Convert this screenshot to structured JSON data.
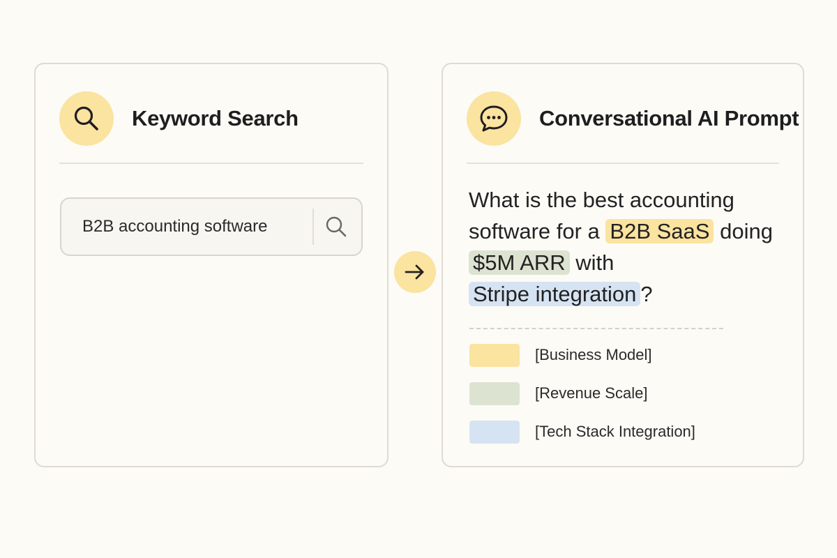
{
  "colors": {
    "accent_yellow": "#fbe3a0",
    "business_model": "#fbe3a0",
    "revenue_scale": "#dde3d1",
    "tech_stack": "#d6e3f2",
    "border": "#dddbd3",
    "background": "#fcfbf6"
  },
  "left_panel": {
    "icon": "search-icon",
    "title": "Keyword Search",
    "search": {
      "value": "B2B accounting software",
      "button_icon": "search-icon"
    }
  },
  "connector": {
    "icon": "arrow-right-icon"
  },
  "right_panel": {
    "icon": "chat-bubble-icon",
    "title": "Conversational AI Prompt",
    "prompt": {
      "part1": "What is the best accounting software for a ",
      "business_model": "B2B SaaS",
      "part2": " doing ",
      "revenue_scale": "$5M ARR",
      "part3": " with ",
      "tech_stack": "Stripe integration",
      "part4": "?"
    },
    "legend": [
      {
        "label": "[Business Model]",
        "color": "#fbe3a0"
      },
      {
        "label": "[Revenue Scale]",
        "color": "#dde3d1"
      },
      {
        "label": "[Tech Stack Integration]",
        "color": "#d6e3f2"
      }
    ]
  }
}
